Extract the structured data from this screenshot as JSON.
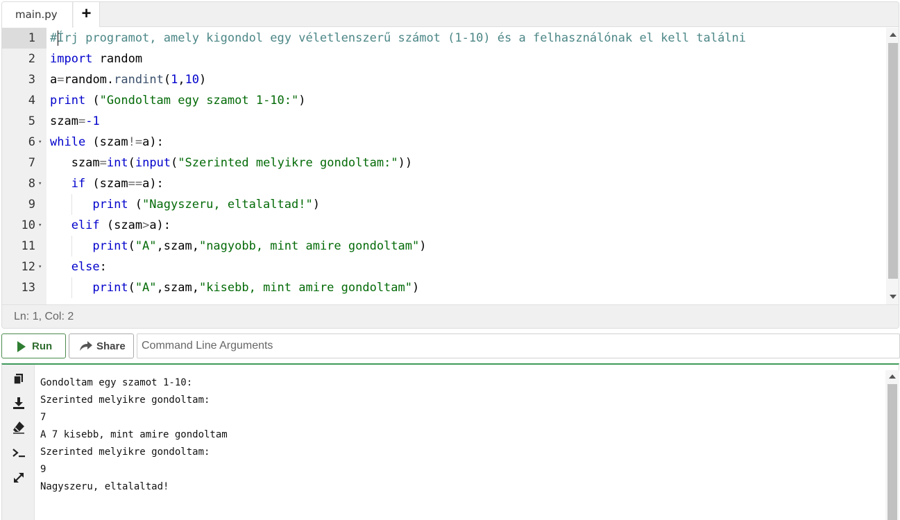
{
  "editor": {
    "tab_label": "main.py",
    "add_tab_label": "+",
    "lines": [
      {
        "n": "1",
        "fold": false,
        "indent": 0,
        "tokens": [
          [
            "cmt",
            "#Írj programot, amely kigondol egy véletlenszerű számot (1-10) és a felhasználónak el kell találni"
          ]
        ]
      },
      {
        "n": "2",
        "fold": false,
        "indent": 0,
        "tokens": [
          [
            "kw",
            "import"
          ],
          [
            "",
            " random"
          ]
        ]
      },
      {
        "n": "3",
        "fold": false,
        "indent": 0,
        "tokens": [
          [
            "",
            "a"
          ],
          [
            "op",
            "="
          ],
          [
            "",
            "random."
          ],
          [
            "attr",
            "randint"
          ],
          [
            "",
            "("
          ],
          [
            "num",
            "1"
          ],
          [
            "",
            ","
          ],
          [
            "num",
            "10"
          ],
          [
            "",
            ")"
          ]
        ]
      },
      {
        "n": "4",
        "fold": false,
        "indent": 0,
        "tokens": [
          [
            "fn",
            "print"
          ],
          [
            "",
            " ("
          ],
          [
            "str",
            "\"Gondoltam egy szamot 1-10:\""
          ],
          [
            "",
            ")"
          ]
        ]
      },
      {
        "n": "5",
        "fold": false,
        "indent": 0,
        "tokens": [
          [
            "",
            "szam"
          ],
          [
            "op",
            "="
          ],
          [
            "num",
            "-1"
          ]
        ]
      },
      {
        "n": "6",
        "fold": true,
        "indent": 0,
        "tokens": [
          [
            "kw",
            "while"
          ],
          [
            "",
            " (szam"
          ],
          [
            "op",
            "!="
          ],
          [
            "",
            "a):"
          ]
        ]
      },
      {
        "n": "7",
        "fold": false,
        "indent": 1,
        "tokens": [
          [
            "",
            "szam"
          ],
          [
            "op",
            "="
          ],
          [
            "fn",
            "int"
          ],
          [
            "",
            "("
          ],
          [
            "fn",
            "input"
          ],
          [
            "",
            "("
          ],
          [
            "str",
            "\"Szerinted melyikre gondoltam:\""
          ],
          [
            "",
            "))"
          ]
        ]
      },
      {
        "n": "8",
        "fold": true,
        "indent": 1,
        "tokens": [
          [
            "kw",
            "if"
          ],
          [
            "",
            " (szam"
          ],
          [
            "op",
            "=="
          ],
          [
            "",
            "a):"
          ]
        ]
      },
      {
        "n": "9",
        "fold": false,
        "indent": 2,
        "tokens": [
          [
            "fn",
            "print"
          ],
          [
            "",
            " ("
          ],
          [
            "str",
            "\"Nagyszeru, eltalaltad!\""
          ],
          [
            "",
            ")"
          ]
        ]
      },
      {
        "n": "10",
        "fold": true,
        "indent": 1,
        "tokens": [
          [
            "kw",
            "elif"
          ],
          [
            "",
            " (szam"
          ],
          [
            "op",
            ">"
          ],
          [
            "",
            "a):"
          ]
        ]
      },
      {
        "n": "11",
        "fold": false,
        "indent": 2,
        "tokens": [
          [
            "fn",
            "print"
          ],
          [
            "",
            "("
          ],
          [
            "str",
            "\"A\""
          ],
          [
            "",
            ",szam,"
          ],
          [
            "str",
            "\"nagyobb, mint amire gondoltam\""
          ],
          [
            "",
            ")"
          ]
        ]
      },
      {
        "n": "12",
        "fold": true,
        "indent": 1,
        "tokens": [
          [
            "kw",
            "else"
          ],
          [
            "",
            ":"
          ]
        ]
      },
      {
        "n": "13",
        "fold": false,
        "indent": 2,
        "tokens": [
          [
            "fn",
            "print"
          ],
          [
            "",
            "("
          ],
          [
            "str",
            "\"A\""
          ],
          [
            "",
            ",szam,"
          ],
          [
            "str",
            "\"kisebb, mint amire gondoltam\""
          ],
          [
            "",
            ")"
          ]
        ]
      }
    ]
  },
  "status": {
    "cursor_position": "Ln: 1,  Col: 2"
  },
  "toolbar": {
    "run_label": "Run",
    "share_label": "Share",
    "args_placeholder": "Command Line Arguments",
    "args_value": ""
  },
  "output": {
    "side_icons": [
      "copy-icon",
      "download-icon",
      "eraser-icon",
      "terminal-icon",
      "expand-icon"
    ],
    "lines": [
      "Gondoltam egy szamot 1-10:",
      "Szerinted melyikre gondoltam:",
      "7",
      "A 7 kisebb, mint amire gondoltam",
      "Szerinted melyikre gondoltam:",
      "9",
      "Nagyszeru, eltalaltad!"
    ]
  },
  "colors": {
    "accent_green": "#3e9a5a",
    "run_text": "#2f6d2f",
    "keyword": "#0000cc",
    "string": "#036a07",
    "comment": "#4c8686"
  }
}
